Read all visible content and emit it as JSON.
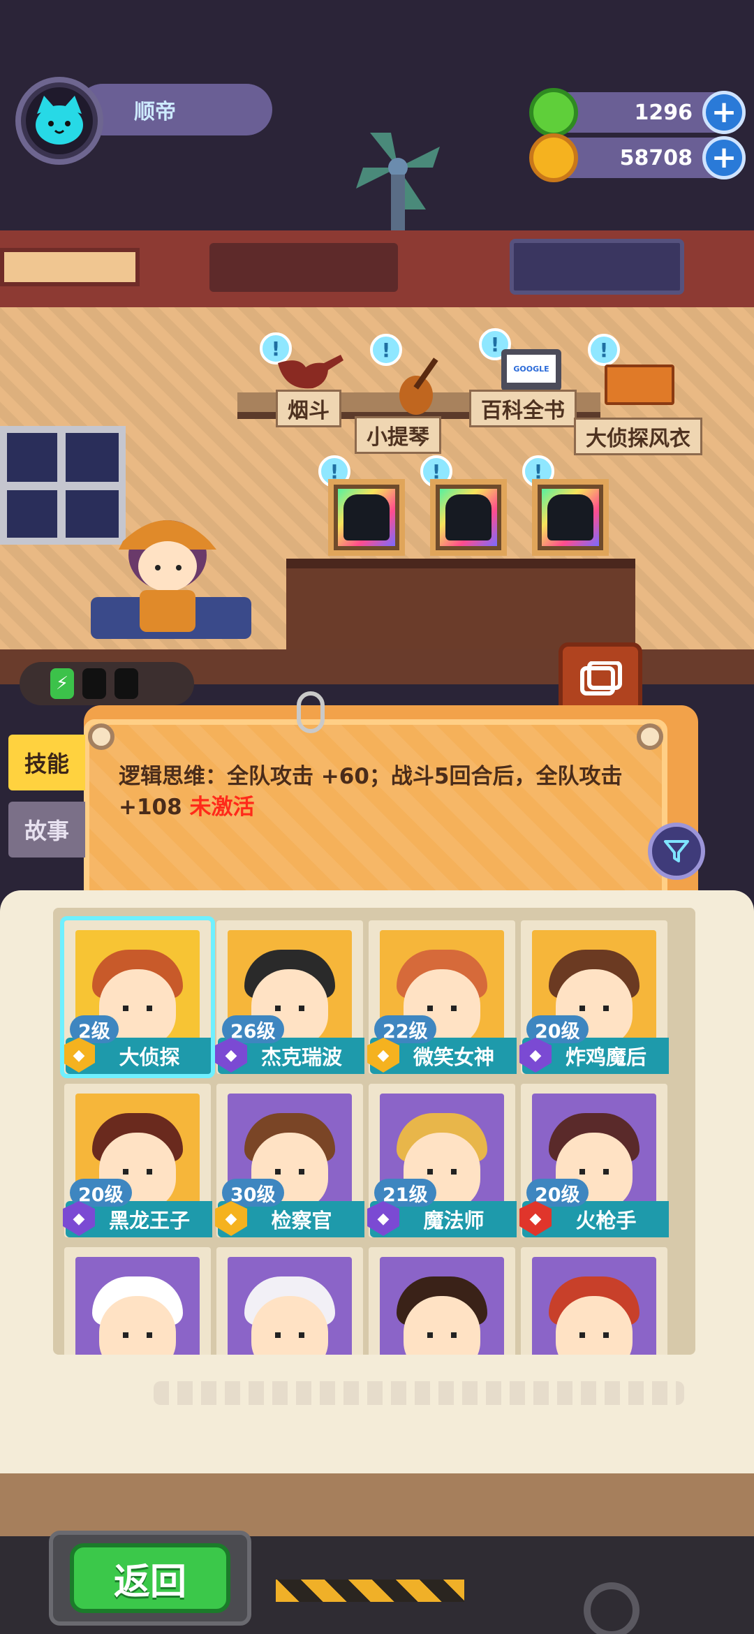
{
  "player": {
    "name": "顺帝"
  },
  "currencies": [
    {
      "name": "gems",
      "value": "1296",
      "color": "#5fcf3a"
    },
    {
      "name": "coins",
      "value": "58708",
      "color": "#f5b21f"
    }
  ],
  "room_items": [
    {
      "label": "烟斗"
    },
    {
      "label": "小提琴"
    },
    {
      "label": "百科全书"
    },
    {
      "label": "大侦探风衣"
    }
  ],
  "item_icons": {
    "encyclopedia_text": "GOOGLE"
  },
  "side_tabs": {
    "skill": "技能",
    "story": "故事"
  },
  "skill": {
    "text": "逻辑思维：全队攻击 +60；战斗5回合后，全队攻击 +108",
    "status": "未激活"
  },
  "heroes": [
    {
      "level": "2级",
      "name": "大侦探",
      "rank": "gold",
      "bg": "#f7c434",
      "hair": "#c85a2a",
      "selected": true
    },
    {
      "level": "26级",
      "name": "杰克瑞波",
      "rank": "purple",
      "bg": "#f6b63a",
      "hair": "#2a2a2a"
    },
    {
      "level": "22级",
      "name": "微笑女神",
      "rank": "gold",
      "bg": "#f6b63a",
      "hair": "#d66a3a"
    },
    {
      "level": "20级",
      "name": "炸鸡魔后",
      "rank": "purple",
      "bg": "#f6b63a",
      "hair": "#6b3a22"
    },
    {
      "level": "20级",
      "name": "黑龙王子",
      "rank": "purple",
      "bg": "#f6b63a",
      "hair": "#6a2a1e"
    },
    {
      "level": "30级",
      "name": "检察官",
      "rank": "gold",
      "bg": "#8b64c8",
      "hair": "#7a4526"
    },
    {
      "level": "21级",
      "name": "魔法师",
      "rank": "purple",
      "bg": "#8b64c8",
      "hair": "#e8b64a"
    },
    {
      "level": "20级",
      "name": "火枪手",
      "rank": "red",
      "bg": "#8b64c8",
      "hair": "#5a2a2a"
    },
    {
      "level": "",
      "name": "",
      "rank": "purple",
      "bg": "#8b64c8",
      "hair": "#ffffff"
    },
    {
      "level": "",
      "name": "",
      "rank": "purple",
      "bg": "#8b64c8",
      "hair": "#f2f0f6"
    },
    {
      "level": "",
      "name": "",
      "rank": "purple",
      "bg": "#8b64c8",
      "hair": "#3a2218"
    },
    {
      "level": "",
      "name": "",
      "rank": "purple",
      "bg": "#8b64c8",
      "hair": "#c8402a"
    }
  ],
  "back_button": "返回"
}
